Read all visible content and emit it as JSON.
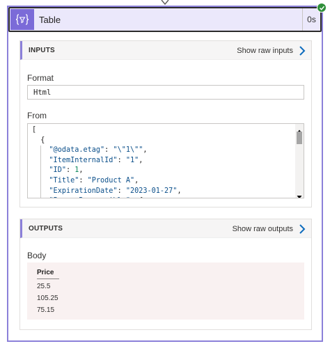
{
  "action": {
    "title": "Table",
    "duration": "0s",
    "icon": "braces-filter-icon",
    "status": "succeeded",
    "accent_color": "#7b6bd8",
    "status_color": "#2f8f3a"
  },
  "inputs": {
    "section_title": "INPUTS",
    "show_raw_label": "Show raw inputs",
    "format_label": "Format",
    "format_value": "Html",
    "from_label": "From",
    "from_code_lines": [
      "[",
      "  {",
      "    \"@odata.etag\": \"\\\"1\\\"\",",
      "    \"ItemInternalId\": \"1\",",
      "    \"ID\": 1,",
      "    \"Title\": \"Product A\",",
      "    \"ExpirationDate\": \"2023-01-27\",",
      "    \"PersonResponsible\": {"
    ]
  },
  "outputs": {
    "section_title": "OUTPUTS",
    "show_raw_label": "Show raw outputs",
    "body_label": "Body",
    "table": {
      "columns": [
        "Price"
      ],
      "rows": [
        [
          "25.5"
        ],
        [
          "105.25"
        ],
        [
          "75.15"
        ]
      ]
    }
  }
}
